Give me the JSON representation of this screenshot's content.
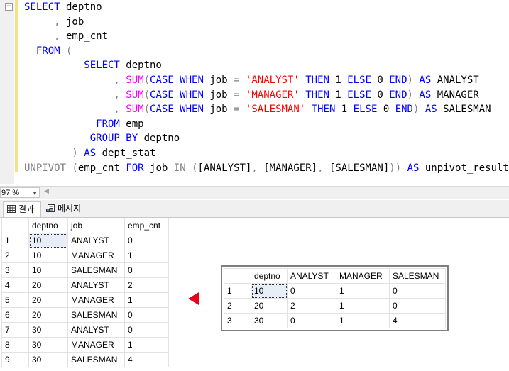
{
  "editor": {
    "lines": [
      [
        [
          "kw",
          "SELECT"
        ],
        [
          "txt",
          " deptno"
        ]
      ],
      [
        [
          "op",
          "     ,"
        ],
        [
          "txt",
          " job"
        ]
      ],
      [
        [
          "op",
          "     ,"
        ],
        [
          "txt",
          " emp_cnt"
        ]
      ],
      [
        [
          "kw",
          "  FROM"
        ],
        [
          "txt",
          " "
        ],
        [
          "op",
          "("
        ]
      ],
      [
        [
          "kw",
          "          SELECT"
        ],
        [
          "txt",
          " deptno"
        ]
      ],
      [
        [
          "op",
          "               ,"
        ],
        [
          "txt",
          " "
        ],
        [
          "fn",
          "SUM"
        ],
        [
          "op",
          "("
        ],
        [
          "kw",
          "CASE WHEN"
        ],
        [
          "txt",
          " job "
        ],
        [
          "op",
          "="
        ],
        [
          "txt",
          " "
        ],
        [
          "str",
          "'ANALYST'"
        ],
        [
          "txt",
          " "
        ],
        [
          "kw",
          "THEN"
        ],
        [
          "txt",
          " 1 "
        ],
        [
          "kw",
          "ELSE"
        ],
        [
          "txt",
          " 0 "
        ],
        [
          "kw",
          "END"
        ],
        [
          "op",
          ")"
        ],
        [
          "txt",
          " "
        ],
        [
          "kw",
          "AS"
        ],
        [
          "txt",
          " ANALYST"
        ]
      ],
      [
        [
          "op",
          "               ,"
        ],
        [
          "txt",
          " "
        ],
        [
          "fn",
          "SUM"
        ],
        [
          "op",
          "("
        ],
        [
          "kw",
          "CASE WHEN"
        ],
        [
          "txt",
          " job "
        ],
        [
          "op",
          "="
        ],
        [
          "txt",
          " "
        ],
        [
          "str",
          "'MANAGER'"
        ],
        [
          "txt",
          " "
        ],
        [
          "kw",
          "THEN"
        ],
        [
          "txt",
          " 1 "
        ],
        [
          "kw",
          "ELSE"
        ],
        [
          "txt",
          " 0 "
        ],
        [
          "kw",
          "END"
        ],
        [
          "op",
          ")"
        ],
        [
          "txt",
          " "
        ],
        [
          "kw",
          "AS"
        ],
        [
          "txt",
          " MANAGER"
        ]
      ],
      [
        [
          "op",
          "               ,"
        ],
        [
          "txt",
          " "
        ],
        [
          "fn",
          "SUM"
        ],
        [
          "op",
          "("
        ],
        [
          "kw",
          "CASE WHEN"
        ],
        [
          "txt",
          " job "
        ],
        [
          "op",
          "="
        ],
        [
          "txt",
          " "
        ],
        [
          "str",
          "'SALESMAN'"
        ],
        [
          "txt",
          " "
        ],
        [
          "kw",
          "THEN"
        ],
        [
          "txt",
          " 1 "
        ],
        [
          "kw",
          "ELSE"
        ],
        [
          "txt",
          " 0 "
        ],
        [
          "kw",
          "END"
        ],
        [
          "op",
          ")"
        ],
        [
          "txt",
          " "
        ],
        [
          "kw",
          "AS"
        ],
        [
          "txt",
          " SALESMAN"
        ]
      ],
      [
        [
          "kw",
          "            FROM"
        ],
        [
          "txt",
          " emp"
        ]
      ],
      [
        [
          "kw",
          "           GROUP BY"
        ],
        [
          "txt",
          " deptno"
        ]
      ],
      [
        [
          "op",
          "        )"
        ],
        [
          "txt",
          " "
        ],
        [
          "kw",
          "AS"
        ],
        [
          "txt",
          " dept_stat"
        ]
      ],
      [
        [
          "op",
          "UNPIVOT"
        ],
        [
          "txt",
          " "
        ],
        [
          "op",
          "("
        ],
        [
          "txt",
          "emp_cnt "
        ],
        [
          "kw",
          "FOR"
        ],
        [
          "txt",
          " job "
        ],
        [
          "op",
          "IN"
        ],
        [
          "txt",
          " "
        ],
        [
          "op",
          "("
        ],
        [
          "txt",
          "[ANALYST]"
        ],
        [
          "op",
          ","
        ],
        [
          "txt",
          " [MANAGER]"
        ],
        [
          "op",
          ","
        ],
        [
          "txt",
          " [SALESMAN]"
        ],
        [
          "op",
          "))"
        ],
        [
          "txt",
          " "
        ],
        [
          "kw",
          "AS"
        ],
        [
          "txt",
          " unpivot_result"
        ]
      ]
    ],
    "colors": {
      "kw": "#0000ff",
      "fn": "#ff00ff",
      "str": "#ff0000",
      "op": "#808080",
      "txt": "#000000"
    }
  },
  "status": {
    "zoom": "97 %"
  },
  "tabs": {
    "results_label": "결과",
    "messages_label": "메시지"
  },
  "result_grid": {
    "columns": [
      "deptno",
      "job",
      "emp_cnt"
    ],
    "rows": [
      [
        "1",
        "10",
        "ANALYST",
        "0"
      ],
      [
        "2",
        "10",
        "MANAGER",
        "1"
      ],
      [
        "3",
        "10",
        "SALESMAN",
        "0"
      ],
      [
        "4",
        "20",
        "ANALYST",
        "2"
      ],
      [
        "5",
        "20",
        "MANAGER",
        "1"
      ],
      [
        "6",
        "20",
        "SALESMAN",
        "0"
      ],
      [
        "7",
        "30",
        "ANALYST",
        "0"
      ],
      [
        "8",
        "30",
        "MANAGER",
        "1"
      ],
      [
        "9",
        "30",
        "SALESMAN",
        "4"
      ]
    ]
  },
  "pivot_grid": {
    "columns": [
      "deptno",
      "ANALYST",
      "MANAGER",
      "SALESMAN"
    ],
    "rows": [
      [
        "1",
        "10",
        "0",
        "1",
        "0"
      ],
      [
        "2",
        "20",
        "2",
        "1",
        "0"
      ],
      [
        "3",
        "30",
        "0",
        "1",
        "4"
      ]
    ]
  },
  "accent": {
    "arrow": "#e8001c",
    "change_bar": "#f3e08a"
  }
}
